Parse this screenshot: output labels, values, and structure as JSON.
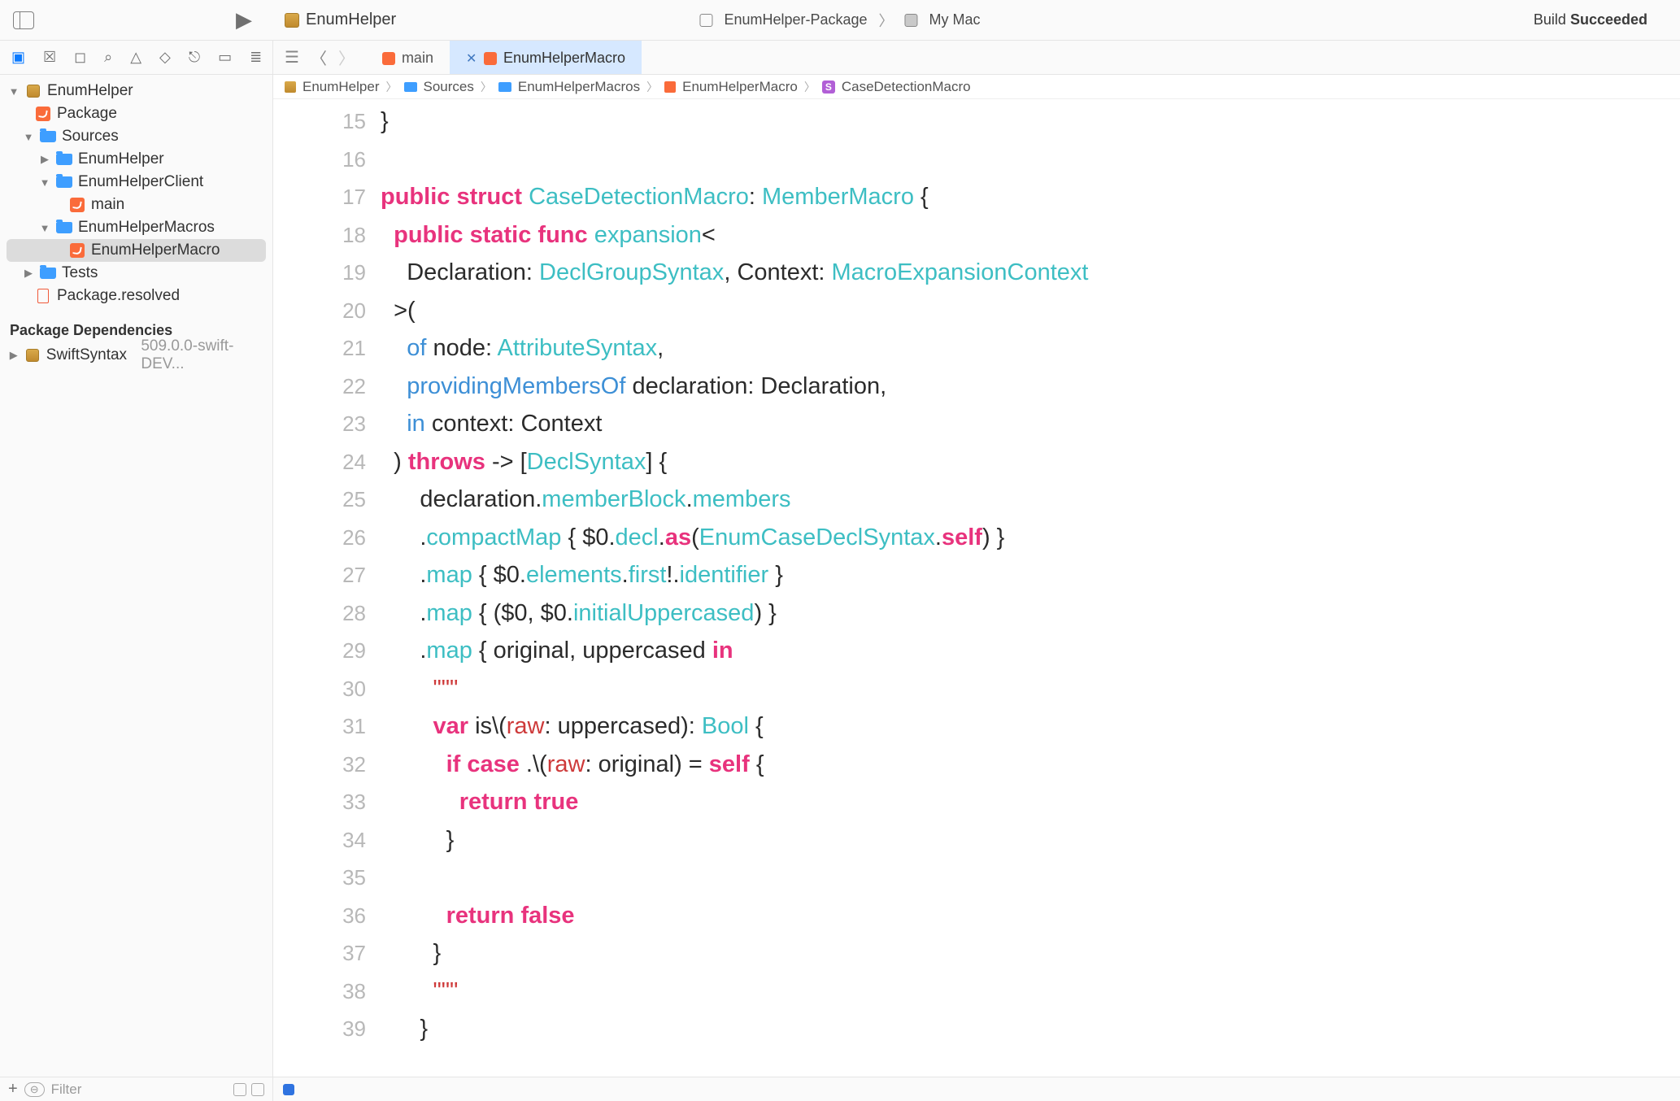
{
  "titlebar": {
    "project_name": "EnumHelper",
    "scheme": "EnumHelper-Package",
    "destination": "My Mac",
    "build_label": "Build",
    "build_status": "Succeeded"
  },
  "sidebar": {
    "root": "EnumHelper",
    "package_label": "Package",
    "sources_label": "Sources",
    "enumhelper_label": "EnumHelper",
    "enumhelperclient_label": "EnumHelperClient",
    "main_label": "main",
    "enumhelpermacros_label": "EnumHelperMacros",
    "enumhelpermacro_label": "EnumHelperMacro",
    "tests_label": "Tests",
    "packageresolved_label": "Package.resolved",
    "deps_header": "Package Dependencies",
    "dep_name": "SwiftSyntax",
    "dep_ver": "509.0.0-swift-DEV...",
    "filter_placeholder": "Filter"
  },
  "tabs": {
    "main_tab": "main",
    "macro_tab": "EnumHelperMacro"
  },
  "jumpbar": {
    "p0": "EnumHelper",
    "p1": "Sources",
    "p2": "EnumHelperMacros",
    "p3": "EnumHelperMacro",
    "p4": "CaseDetectionMacro"
  },
  "code": {
    "first_line_no": 15,
    "lines": [
      {
        "t": [
          [
            "plain",
            "}"
          ]
        ]
      },
      {
        "t": [
          [
            "plain",
            ""
          ]
        ]
      },
      {
        "t": [
          [
            "kw-pink",
            "public"
          ],
          [
            "plain",
            " "
          ],
          [
            "kw-pink",
            "struct"
          ],
          [
            "plain",
            " "
          ],
          [
            "type",
            "CaseDetectionMacro"
          ],
          [
            "punc",
            ": "
          ],
          [
            "type",
            "MemberMacro"
          ],
          [
            "punc",
            " {"
          ]
        ]
      },
      {
        "t": [
          [
            "plain",
            "  "
          ],
          [
            "kw-pink",
            "public"
          ],
          [
            "plain",
            " "
          ],
          [
            "kw-pink",
            "static"
          ],
          [
            "plain",
            " "
          ],
          [
            "kw-pink",
            "func"
          ],
          [
            "plain",
            " "
          ],
          [
            "func",
            "expansion"
          ],
          [
            "punc",
            "<"
          ]
        ]
      },
      {
        "t": [
          [
            "plain",
            "    Declaration: "
          ],
          [
            "type",
            "DeclGroupSyntax"
          ],
          [
            "punc",
            ", "
          ],
          [
            "plain",
            "Context: "
          ],
          [
            "type",
            "MacroExpansionContext"
          ]
        ]
      },
      {
        "t": [
          [
            "plain",
            "  "
          ],
          [
            "punc",
            ">("
          ]
        ]
      },
      {
        "t": [
          [
            "plain",
            "    "
          ],
          [
            "param",
            "of"
          ],
          [
            "plain",
            " node: "
          ],
          [
            "type",
            "AttributeSyntax"
          ],
          [
            "punc",
            ","
          ]
        ]
      },
      {
        "t": [
          [
            "plain",
            "    "
          ],
          [
            "param",
            "providingMembersOf"
          ],
          [
            "plain",
            " declaration: Declaration,"
          ]
        ]
      },
      {
        "t": [
          [
            "plain",
            "    "
          ],
          [
            "param",
            "in"
          ],
          [
            "plain",
            " context: Context"
          ]
        ]
      },
      {
        "t": [
          [
            "plain",
            "  ) "
          ],
          [
            "kw-pink",
            "throws"
          ],
          [
            "plain",
            " -> ["
          ],
          [
            "type",
            "DeclSyntax"
          ],
          [
            "punc",
            "] {"
          ]
        ]
      },
      {
        "t": [
          [
            "plain",
            "      declaration."
          ],
          [
            "member",
            "memberBlock"
          ],
          [
            "punc",
            "."
          ],
          [
            "member",
            "members"
          ]
        ]
      },
      {
        "t": [
          [
            "plain",
            "      ."
          ],
          [
            "member",
            "compactMap"
          ],
          [
            "plain",
            " { $0."
          ],
          [
            "member",
            "decl"
          ],
          [
            "punc",
            "."
          ],
          [
            "kw-pink",
            "as"
          ],
          [
            "punc",
            "("
          ],
          [
            "type",
            "EnumCaseDeclSyntax"
          ],
          [
            "punc",
            "."
          ],
          [
            "kw-pink",
            "self"
          ],
          [
            "punc",
            ") }"
          ]
        ]
      },
      {
        "t": [
          [
            "plain",
            "      ."
          ],
          [
            "member",
            "map"
          ],
          [
            "plain",
            " { $0."
          ],
          [
            "member",
            "elements"
          ],
          [
            "punc",
            "."
          ],
          [
            "member",
            "first"
          ],
          [
            "punc",
            "!."
          ],
          [
            "member",
            "identifier"
          ],
          [
            "punc",
            " }"
          ]
        ]
      },
      {
        "t": [
          [
            "plain",
            "      ."
          ],
          [
            "member",
            "map"
          ],
          [
            "plain",
            " { ($0, $0."
          ],
          [
            "member",
            "initialUppercased"
          ],
          [
            "punc",
            ") }"
          ]
        ]
      },
      {
        "t": [
          [
            "plain",
            "      ."
          ],
          [
            "member",
            "map"
          ],
          [
            "plain",
            " { original, uppercased "
          ],
          [
            "kw-pink",
            "in"
          ]
        ]
      },
      {
        "t": [
          [
            "plain",
            "        "
          ],
          [
            "str",
            "\"\"\""
          ]
        ]
      },
      {
        "t": [
          [
            "plain",
            "        "
          ],
          [
            "kw-pink",
            "var"
          ],
          [
            "plain",
            " is"
          ],
          [
            "punc",
            "\\("
          ],
          [
            "str",
            "raw"
          ],
          [
            "punc",
            ": "
          ],
          [
            "plain",
            "uppercased): "
          ],
          [
            "type",
            "Bool"
          ],
          [
            "punc",
            " {"
          ]
        ]
      },
      {
        "t": [
          [
            "plain",
            "          "
          ],
          [
            "kw-pink",
            "if"
          ],
          [
            "plain",
            " "
          ],
          [
            "kw-pink",
            "case"
          ],
          [
            "plain",
            " ."
          ],
          [
            "punc",
            "\\("
          ],
          [
            "str",
            "raw"
          ],
          [
            "punc",
            ": "
          ],
          [
            "plain",
            "original) = "
          ],
          [
            "kw-pink",
            "self"
          ],
          [
            "punc",
            " {"
          ]
        ]
      },
      {
        "t": [
          [
            "plain",
            "            "
          ],
          [
            "kw-pink",
            "return"
          ],
          [
            "plain",
            " "
          ],
          [
            "kw-pink",
            "true"
          ]
        ]
      },
      {
        "t": [
          [
            "plain",
            "          }"
          ]
        ]
      },
      {
        "t": [
          [
            "plain",
            ""
          ]
        ]
      },
      {
        "t": [
          [
            "plain",
            "          "
          ],
          [
            "kw-pink",
            "return"
          ],
          [
            "plain",
            " "
          ],
          [
            "kw-pink",
            "false"
          ]
        ]
      },
      {
        "t": [
          [
            "plain",
            "        }"
          ]
        ]
      },
      {
        "t": [
          [
            "plain",
            "        "
          ],
          [
            "str",
            "\"\"\""
          ]
        ]
      },
      {
        "t": [
          [
            "plain",
            "      }"
          ]
        ]
      }
    ]
  }
}
